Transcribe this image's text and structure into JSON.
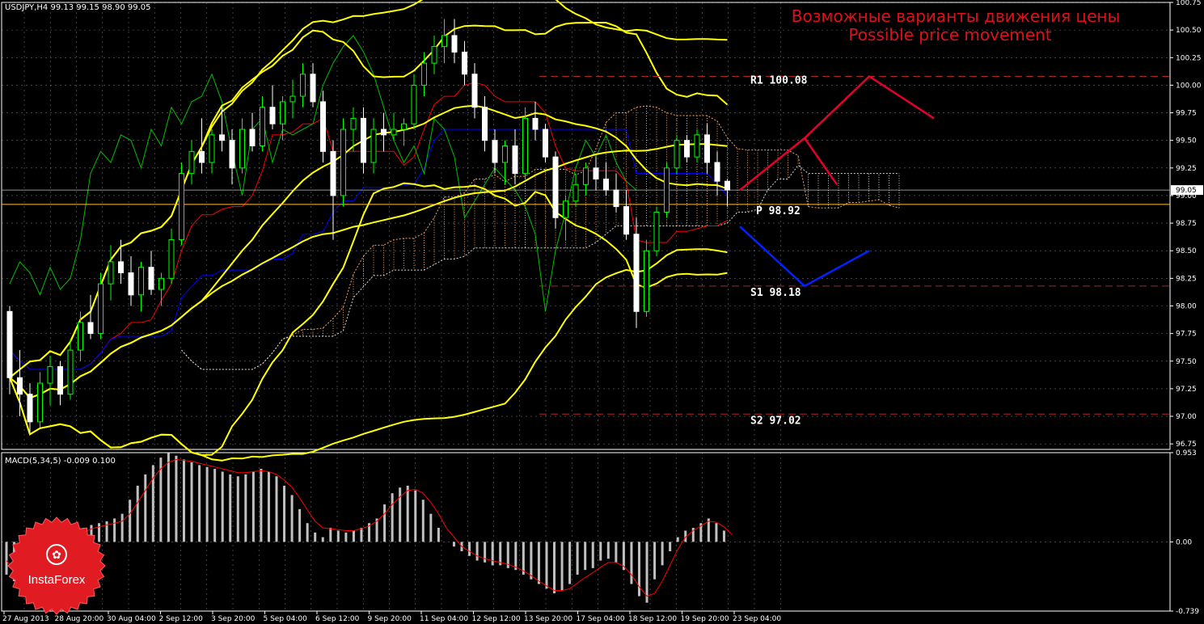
{
  "header": {
    "symbol_info": "USDJPY,H4  99.13 99.15 98.90 99.05",
    "title_ru": "Возможные варианты движения цены",
    "title_en": "Possible price movement"
  },
  "colors": {
    "background": "#000000",
    "grid": "#c0c0c0",
    "bullish_candle": "#00ff00",
    "bearish_candle": "#ffffff",
    "bollinger": "#ffff00",
    "tenkan": "#ff0000",
    "kijun": "#0000ff",
    "chikou": "#00c000",
    "cloud_up": "#f4a460",
    "cloud_down": "#d8d8d8",
    "scenario_up": "#e4002b",
    "scenario_down": "#0022ff",
    "macd_hist": "#c0c0c0",
    "macd_signal": "#ff0000",
    "pivot_line": "#ffbf40",
    "level_line": "#b22222"
  },
  "logo": {
    "text": "InstaForex",
    "icon": "instaforex-logo-icon"
  },
  "chart_data": [
    {
      "type": "candlestick",
      "panel": "price",
      "symbol": "USDJPY",
      "timeframe": "H4",
      "ylim": [
        96.7,
        100.75
      ],
      "y_ticks": [
        "100.75",
        "100.50",
        "100.25",
        "100.00",
        "99.75",
        "99.50",
        "99.25",
        "99.00",
        "98.75",
        "98.50",
        "98.25",
        "98.00",
        "97.75",
        "97.50",
        "97.25",
        "97.00",
        "96.75"
      ],
      "current_price_label": "99.05",
      "x_labels": [
        "27 Aug 2013",
        "28 Aug 20:00",
        "30 Aug 04:00",
        "2 Sep 12:00",
        "3 Sep 20:00",
        "5 Sep 04:00",
        "6 Sep 12:00",
        "9 Sep 20:00",
        "11 Sep 04:00",
        "12 Sep 12:00",
        "13 Sep 20:00",
        "17 Sep 04:00",
        "18 Sep 12:00",
        "19 Sep 20:00",
        "23 Sep 04:00"
      ],
      "candles": [
        [
          97.95,
          98.0,
          97.2,
          97.35
        ],
        [
          97.35,
          97.6,
          97.0,
          97.2
        ],
        [
          97.2,
          97.3,
          96.85,
          96.95
        ],
        [
          96.95,
          97.4,
          96.9,
          97.3
        ],
        [
          97.3,
          97.55,
          97.1,
          97.45
        ],
        [
          97.45,
          97.5,
          97.1,
          97.2
        ],
        [
          97.2,
          97.7,
          97.15,
          97.6
        ],
        [
          97.6,
          97.95,
          97.5,
          97.85
        ],
        [
          97.85,
          98.1,
          97.7,
          97.75
        ],
        [
          97.75,
          98.3,
          97.7,
          98.2
        ],
        [
          98.2,
          98.55,
          98.05,
          98.4
        ],
        [
          98.4,
          98.6,
          98.2,
          98.3
        ],
        [
          98.3,
          98.45,
          98.0,
          98.1
        ],
        [
          98.1,
          98.4,
          97.95,
          98.35
        ],
        [
          98.35,
          98.5,
          98.1,
          98.15
        ],
        [
          98.15,
          98.3,
          98.0,
          98.25
        ],
        [
          98.25,
          98.7,
          98.2,
          98.6
        ],
        [
          98.6,
          99.3,
          98.55,
          99.2
        ],
        [
          99.2,
          99.5,
          99.1,
          99.4
        ],
        [
          99.4,
          99.7,
          99.2,
          99.3
        ],
        [
          99.3,
          99.6,
          99.2,
          99.55
        ],
        [
          99.55,
          99.8,
          99.4,
          99.5
        ],
        [
          99.5,
          99.6,
          99.1,
          99.25
        ],
        [
          99.25,
          99.7,
          99.2,
          99.6
        ],
        [
          99.6,
          99.75,
          99.4,
          99.45
        ],
        [
          99.45,
          99.9,
          99.4,
          99.8
        ],
        [
          99.8,
          100.0,
          99.6,
          99.65
        ],
        [
          99.65,
          99.9,
          99.5,
          99.85
        ],
        [
          99.85,
          100.05,
          99.7,
          99.9
        ],
        [
          99.9,
          100.2,
          99.8,
          100.1
        ],
        [
          100.1,
          100.2,
          99.8,
          99.85
        ],
        [
          99.85,
          99.95,
          99.3,
          99.4
        ],
        [
          99.4,
          99.5,
          98.6,
          99.0
        ],
        [
          99.0,
          99.7,
          98.9,
          99.6
        ],
        [
          99.6,
          99.8,
          99.4,
          99.7
        ],
        [
          99.7,
          99.8,
          99.2,
          99.3
        ],
        [
          99.3,
          99.7,
          99.2,
          99.6
        ],
        [
          99.6,
          99.75,
          99.4,
          99.55
        ],
        [
          99.55,
          99.75,
          99.5,
          99.6
        ],
        [
          99.6,
          99.7,
          99.45,
          99.65
        ],
        [
          99.65,
          100.1,
          99.6,
          100.0
        ],
        [
          100.0,
          100.3,
          99.9,
          100.2
        ],
        [
          100.2,
          100.45,
          100.1,
          100.35
        ],
        [
          100.35,
          100.6,
          100.2,
          100.45
        ],
        [
          100.45,
          100.6,
          100.2,
          100.3
        ],
        [
          100.3,
          100.4,
          100.0,
          100.1
        ],
        [
          100.1,
          100.2,
          99.7,
          99.8
        ],
        [
          99.8,
          99.9,
          99.4,
          99.5
        ],
        [
          99.5,
          99.6,
          99.2,
          99.3
        ],
        [
          99.3,
          99.5,
          99.1,
          99.45
        ],
        [
          99.45,
          99.6,
          99.1,
          99.2
        ],
        [
          99.2,
          99.8,
          99.15,
          99.7
        ],
        [
          99.7,
          99.85,
          99.5,
          99.6
        ],
        [
          99.6,
          99.65,
          99.3,
          99.35
        ],
        [
          99.35,
          99.4,
          98.7,
          98.8
        ],
        [
          98.8,
          99.0,
          98.6,
          98.95
        ],
        [
          98.95,
          99.2,
          98.9,
          99.1
        ],
        [
          99.1,
          99.3,
          99.0,
          99.25
        ],
        [
          99.25,
          99.35,
          99.05,
          99.15
        ],
        [
          99.15,
          99.3,
          99.0,
          99.05
        ],
        [
          99.05,
          99.2,
          98.85,
          98.9
        ],
        [
          98.9,
          99.05,
          98.6,
          98.65
        ],
        [
          98.65,
          98.8,
          97.8,
          97.95
        ],
        [
          97.95,
          98.6,
          97.9,
          98.5
        ],
        [
          98.5,
          98.9,
          98.45,
          98.85
        ],
        [
          98.85,
          99.3,
          98.8,
          99.25
        ],
        [
          99.25,
          99.55,
          99.2,
          99.5
        ],
        [
          99.5,
          99.55,
          99.3,
          99.35
        ],
        [
          99.35,
          99.6,
          99.3,
          99.55
        ],
        [
          99.55,
          99.65,
          99.2,
          99.3
        ],
        [
          99.3,
          99.4,
          99.0,
          99.13
        ],
        [
          99.13,
          99.15,
          98.9,
          99.05
        ]
      ],
      "pivot_levels": [
        {
          "label": "R1 100.08",
          "value": 100.08
        },
        {
          "label": "P 98.92",
          "value": 98.92
        },
        {
          "label": "S1 98.18",
          "value": 98.18
        },
        {
          "label": "S2 97.02",
          "value": 97.02
        }
      ],
      "scenario_up": [
        [
          99.05,
          0
        ],
        [
          99.52,
          1
        ],
        [
          100.08,
          2
        ],
        [
          99.7,
          3
        ]
      ],
      "scenario_up_branch": [
        [
          99.52,
          1
        ],
        [
          99.1,
          1.5
        ]
      ],
      "scenario_down": [
        [
          98.72,
          0
        ],
        [
          98.18,
          1
        ],
        [
          98.5,
          2
        ]
      ]
    },
    {
      "type": "bar",
      "panel": "indicator",
      "title": "MACD(5,34,5) -0.009 0.100",
      "ylim": [
        -0.739,
        0.953
      ],
      "y_ticks": [
        "0.953",
        "0.00",
        "-0.739"
      ],
      "values": [
        -0.35,
        -0.42,
        -0.38,
        -0.3,
        -0.2,
        -0.1,
        -0.05,
        0.0,
        0.05,
        0.1,
        0.15,
        0.18,
        0.2,
        0.22,
        0.25,
        0.3,
        0.45,
        0.6,
        0.72,
        0.82,
        0.9,
        0.95,
        0.92,
        0.88,
        0.85,
        0.82,
        0.8,
        0.78,
        0.75,
        0.72,
        0.7,
        0.72,
        0.75,
        0.78,
        0.75,
        0.7,
        0.6,
        0.5,
        0.35,
        0.2,
        0.1,
        0.05,
        0.15,
        0.12,
        0.1,
        0.12,
        0.15,
        0.2,
        0.25,
        0.4,
        0.52,
        0.58,
        0.6,
        0.55,
        0.45,
        0.3,
        0.15,
        0.0,
        -0.05,
        -0.1,
        -0.15,
        -0.2,
        -0.22,
        -0.25,
        -0.25,
        -0.28,
        -0.3,
        -0.35,
        -0.4,
        -0.45,
        -0.5,
        -0.55,
        -0.52,
        -0.45,
        -0.35,
        -0.3,
        -0.28,
        -0.2,
        -0.18,
        -0.22,
        -0.3,
        -0.45,
        -0.58,
        -0.65,
        -0.4,
        -0.25,
        -0.1,
        0.05,
        0.12,
        0.15,
        0.2,
        0.25,
        0.2,
        0.12,
        0.0
      ],
      "signal": [
        -0.2,
        -0.3,
        -0.35,
        -0.33,
        -0.28,
        -0.2,
        -0.12,
        -0.05,
        0.0,
        0.05,
        0.1,
        0.14,
        0.16,
        0.18,
        0.2,
        0.22,
        0.3,
        0.42,
        0.55,
        0.68,
        0.78,
        0.85,
        0.88,
        0.87,
        0.86,
        0.84,
        0.82,
        0.8,
        0.78,
        0.76,
        0.74,
        0.74,
        0.75,
        0.76,
        0.75,
        0.72,
        0.66,
        0.58,
        0.47,
        0.34,
        0.22,
        0.15,
        0.14,
        0.13,
        0.12,
        0.12,
        0.14,
        0.17,
        0.22,
        0.3,
        0.4,
        0.48,
        0.55,
        0.56,
        0.52,
        0.42,
        0.3,
        0.15,
        0.05,
        -0.05,
        -0.1,
        -0.15,
        -0.18,
        -0.2,
        -0.22,
        -0.24,
        -0.27,
        -0.31,
        -0.36,
        -0.42,
        -0.47,
        -0.52,
        -0.52,
        -0.5,
        -0.44,
        -0.38,
        -0.33,
        -0.27,
        -0.22,
        -0.22,
        -0.26,
        -0.35,
        -0.48,
        -0.58,
        -0.55,
        -0.42,
        -0.25,
        -0.08,
        0.05,
        0.12,
        0.17,
        0.22,
        0.21,
        0.16,
        0.08
      ]
    }
  ]
}
